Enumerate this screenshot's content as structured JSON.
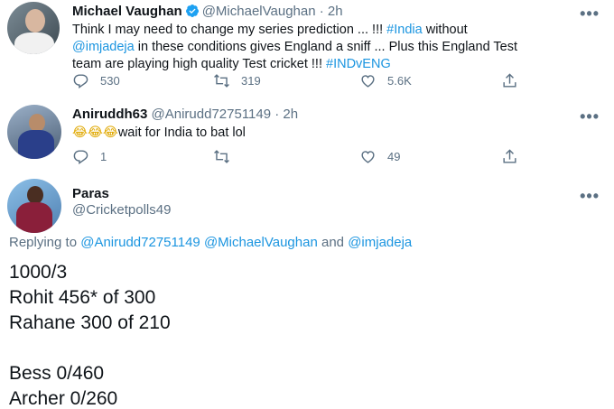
{
  "tweet1": {
    "name": "Michael Vaughan",
    "handle": "@MichaelVaughan",
    "time": "· 2h",
    "text_a": "Think I may need to change my series prediction ... !!! ",
    "tag_india": "#India",
    "text_b": " without",
    "mention_jadeja": "@imjadeja",
    "text_c": " in these conditions gives England a sniff ... Plus this England Test",
    "text_d": "team are playing high quality Test cricket !!! ",
    "tag_indveng": "#INDvENG",
    "replies": "530",
    "retweets": "319",
    "likes": "5.6K"
  },
  "tweet2": {
    "name": "Aniruddh63",
    "handle": "@Anirudd72751149",
    "time": "· 2h",
    "emoji": "😂😂😂",
    "text": "wait for India to bat lol",
    "replies": "1",
    "retweets": "",
    "likes": "49"
  },
  "tweet3": {
    "name": "Paras",
    "handle": "@Cricketpolls49",
    "replying_prefix": "Replying to ",
    "replying_to": "@Anirudd72751149 @MichaelVaughan",
    "replying_and": " and ",
    "replying_last": "@imjadeja",
    "lines": [
      "1000/3",
      "Rohit 456* of 300",
      "Rahane 300 of 210",
      "Bess 0/460",
      "Archer 0/260"
    ]
  },
  "more_glyph": "•••",
  "colors": {
    "link": "#1b95e0",
    "muted": "#5b7083",
    "verified": "#1da1f2"
  },
  "icons": [
    "reply-icon",
    "retweet-icon",
    "like-icon",
    "share-icon",
    "verified-icon",
    "more-icon"
  ]
}
